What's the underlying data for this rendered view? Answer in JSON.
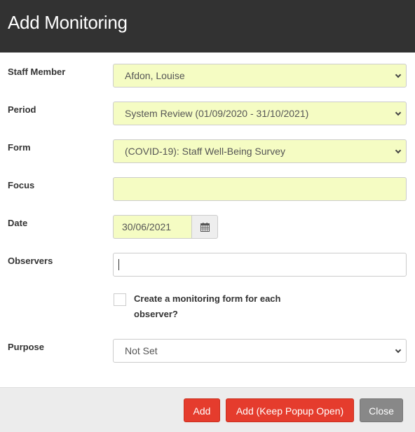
{
  "dialog": {
    "title": "Add Monitoring"
  },
  "form": {
    "staff_member": {
      "label": "Staff Member",
      "value": "Afdon, Louise"
    },
    "period": {
      "label": "Period",
      "value": "System Review (01/09/2020 - 31/10/2021)"
    },
    "form": {
      "label": "Form",
      "value": "(COVID-19): Staff Well-Being Survey"
    },
    "focus": {
      "label": "Focus",
      "value": ""
    },
    "date": {
      "label": "Date",
      "value": "30/06/2021",
      "icon": "calendar-icon"
    },
    "observers": {
      "label": "Observers",
      "value": ""
    },
    "create_each": {
      "label": "Create a monitoring form for each observer?",
      "checked": false
    },
    "purpose": {
      "label": "Purpose",
      "value": "Not Set"
    }
  },
  "footer": {
    "add_label": "Add",
    "add_keep_open_label": "Add (Keep Popup Open)",
    "close_label": "Close"
  },
  "colors": {
    "header_bg": "#323232",
    "required_bg": "#f5fcc3",
    "primary_btn": "#e53c2d",
    "secondary_btn": "#888888"
  }
}
